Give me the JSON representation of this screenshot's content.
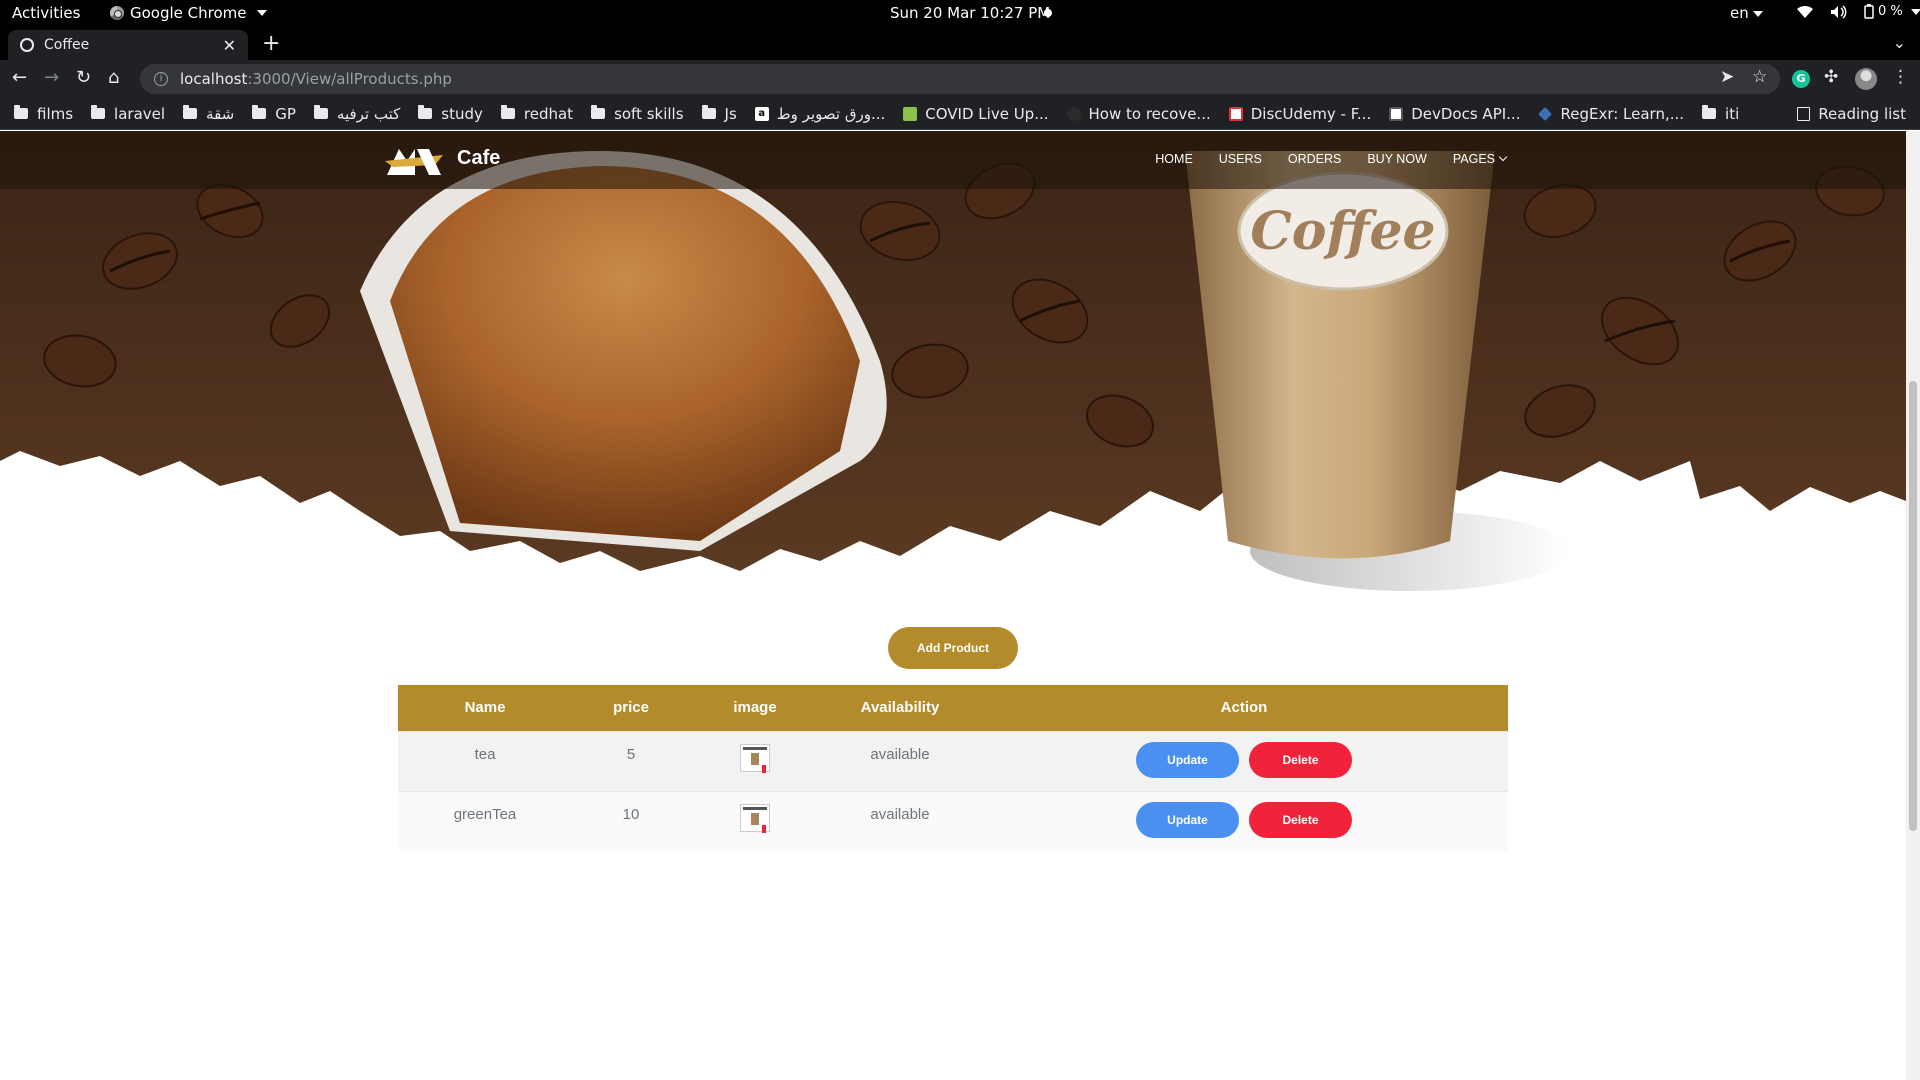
{
  "os_bar": {
    "activities": "Activities",
    "app_name": "Google Chrome",
    "clock": "Sun 20 Mar  10:27 PM",
    "language": "en",
    "battery": "0 %"
  },
  "browser": {
    "tab_title": "Coffee",
    "url_host": "localhost",
    "url_rest": ":3000/View/allProducts.php",
    "bookmarks": [
      {
        "label": "films",
        "icon": "folder-icon"
      },
      {
        "label": "laravel",
        "icon": "folder-icon"
      },
      {
        "label": "شقة",
        "icon": "folder-icon"
      },
      {
        "label": "GP",
        "icon": "folder-icon"
      },
      {
        "label": "كتب ترفيه",
        "icon": "folder-icon"
      },
      {
        "label": "study",
        "icon": "folder-icon"
      },
      {
        "label": "redhat",
        "icon": "folder-icon"
      },
      {
        "label": "soft skills",
        "icon": "folder-icon"
      },
      {
        "label": "Js",
        "icon": "folder-icon"
      },
      {
        "label": "ورق تصوير وط...",
        "icon": "amazon-icon"
      },
      {
        "label": "COVID Live Up...",
        "icon": "worldometer-icon"
      },
      {
        "label": "How to recove...",
        "icon": "github-icon"
      },
      {
        "label": "DiscUdemy - F...",
        "icon": "discudemy-icon"
      },
      {
        "label": "DevDocs API...",
        "icon": "devdocs-icon"
      },
      {
        "label": "RegExr: Learn,...",
        "icon": "regexr-icon"
      },
      {
        "label": "iti",
        "icon": "folder-icon"
      }
    ],
    "reading_list": "Reading list"
  },
  "site": {
    "brand": "Cafe",
    "nav": {
      "home": "HOME",
      "users": "USERS",
      "orders": "ORDERS",
      "buy_now": "BUY NOW",
      "pages": "PAGES"
    },
    "cup_label": "Coffee",
    "add_product": "Add Product",
    "table": {
      "headers": [
        "Name",
        "price",
        "image",
        "Availability",
        "Action"
      ],
      "rows": [
        {
          "name": "tea",
          "price": "5",
          "availability": "available"
        },
        {
          "name": "greenTea",
          "price": "10",
          "availability": "available"
        }
      ],
      "update_label": "Update",
      "delete_label": "Delete"
    }
  },
  "colors": {
    "accent_gold": "#b48b2a",
    "update_blue": "#4a90f0",
    "delete_red": "#f0233b"
  }
}
